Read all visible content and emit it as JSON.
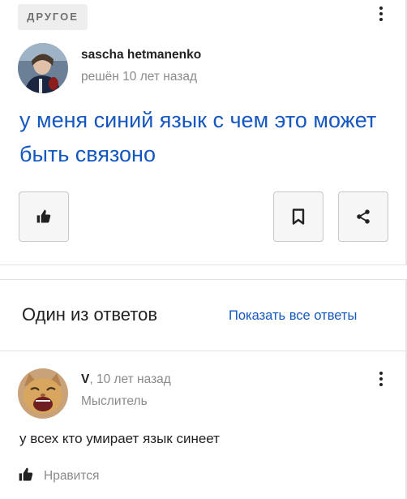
{
  "question": {
    "category": "ДРУГОЕ",
    "author": "sascha hetmanenko",
    "meta": "решён 10 лет назад",
    "text": "у меня синий язык с чем это может быть связоно"
  },
  "answers_section": {
    "title": "Один из ответов",
    "show_all_label": "Показать все ответы"
  },
  "answer": {
    "author": "V",
    "time": ", 10 лет назад",
    "rank": "Мыслитель",
    "text": "у всех кто умирает язык синеет",
    "like_label": "Нравится"
  },
  "colors": {
    "link": "#1557c0",
    "muted": "#8a8a8a",
    "category_bg": "#eeeeee"
  },
  "icons": {
    "like": "thumbs-up-icon",
    "bookmark": "bookmark-icon",
    "share": "share-icon",
    "menu": "vertical-dots-icon"
  }
}
